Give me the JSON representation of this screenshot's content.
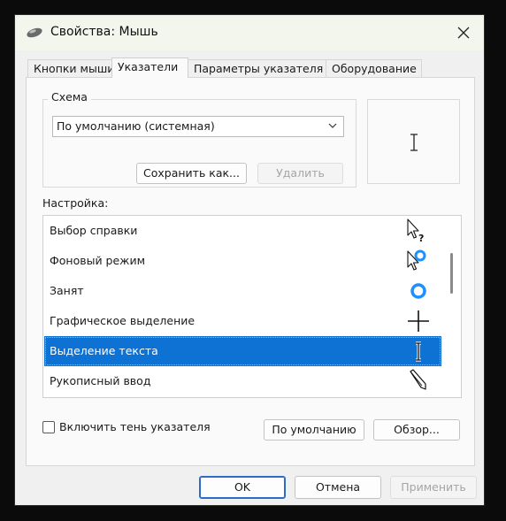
{
  "window": {
    "title": "Свойства: Мышь"
  },
  "tabs": [
    {
      "label": "Кнопки мыши"
    },
    {
      "label": "Указатели"
    },
    {
      "label": "Параметры указателя"
    },
    {
      "label": "Оборудование"
    }
  ],
  "scheme": {
    "label": "Схема",
    "selected": "По умолчанию (системная)",
    "save_button": "Сохранить как...",
    "delete_button": "Удалить"
  },
  "customize": {
    "label": "Настройка:",
    "items": [
      {
        "label": "Выбор справки",
        "icon": "help-select-cursor-icon"
      },
      {
        "label": "Фоновый режим",
        "icon": "working-in-background-cursor-icon"
      },
      {
        "label": "Занят",
        "icon": "busy-cursor-icon"
      },
      {
        "label": "Графическое выделение",
        "icon": "precision-select-cursor-icon"
      },
      {
        "label": "Выделение текста",
        "icon": "text-select-cursor-icon",
        "selected": true
      },
      {
        "label": "Рукописный ввод",
        "icon": "handwriting-cursor-icon"
      }
    ]
  },
  "options": {
    "shadow_checkbox": "Включить тень указателя",
    "shadow_checked": false,
    "default_button": "По умолчанию",
    "browse_button": "Обзор..."
  },
  "footer": {
    "ok": "OK",
    "cancel": "Отмена",
    "apply": "Применить"
  },
  "colors": {
    "selection": "#0d72d4",
    "busy_ring": "#1e90ff"
  }
}
